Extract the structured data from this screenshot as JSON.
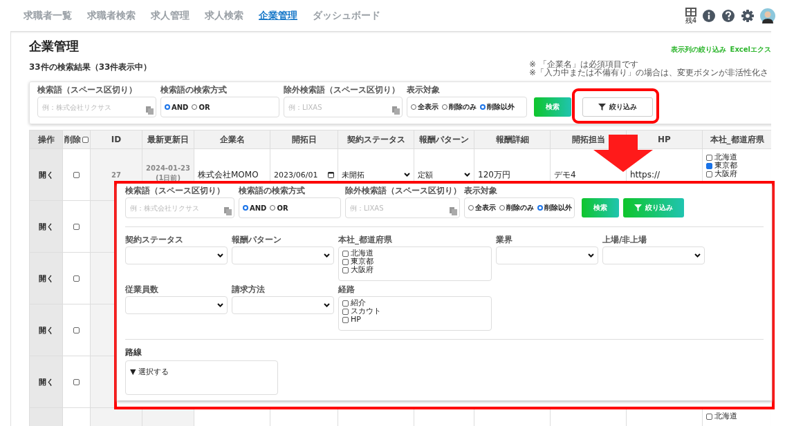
{
  "nav": {
    "tabs": [
      {
        "label": "求職者一覧",
        "selected": false
      },
      {
        "label": "求職者検索",
        "selected": false
      },
      {
        "label": "求人管理",
        "selected": false
      },
      {
        "label": "求人検索",
        "selected": false
      },
      {
        "label": "企業管理",
        "selected": true
      },
      {
        "label": "ダッシュボード",
        "selected": false
      }
    ],
    "quota": "残4"
  },
  "page": {
    "title": "企業管理",
    "result_count": "33件の検索結果（33件表示中）",
    "links": [
      "表示列の絞り込み",
      "Excelエクス"
    ],
    "notes": [
      "※ 「企業名」は必須項目です",
      "※「入力中または不備有り」の場合は、変更ボタンが非活性化さ"
    ]
  },
  "search_bar": {
    "keyword": {
      "label": "検索語（スペース区切り）",
      "placeholder": "例：株式会社リクサス"
    },
    "method": {
      "label": "検索語の検索方式",
      "options": [
        {
          "label": "AND",
          "selected": true
        },
        {
          "label": "OR",
          "selected": false
        }
      ]
    },
    "exclude": {
      "label": "除外検索語（スペース区切り）",
      "placeholder": "例：LIXAS"
    },
    "scope": {
      "label": "表示対象",
      "options": [
        {
          "label": "全表示",
          "selected": false
        },
        {
          "label": "削除のみ",
          "selected": false
        },
        {
          "label": "削除以外",
          "selected": true
        }
      ]
    },
    "search_button": "検索",
    "filter_button": "絞り込み"
  },
  "table": {
    "columns": [
      "操作",
      "削除",
      "ID",
      "最新更新日",
      "企業名",
      "開拓日",
      "契約ステータス",
      "報酬パターン",
      "報酬詳細",
      "開拓担当",
      "HP",
      "本社_都道府県"
    ],
    "delete_all_checked": false,
    "rows": [
      {
        "open": "開く",
        "deleted": false,
        "id": "27",
        "updated": "2024-01-23",
        "updated_ago": "(1日前)",
        "company": "株式会社MOMO",
        "date": "2023/06/01",
        "status": "未開拓",
        "pattern": "定額",
        "detail": "120万円",
        "owner": "デモ4",
        "hp": "https://",
        "prefectures": [
          {
            "label": "北海道",
            "checked": false
          },
          {
            "label": "東京都",
            "checked": true
          },
          {
            "label": "大阪府",
            "checked": false
          }
        ]
      },
      {
        "open": "開く",
        "deleted": false
      },
      {
        "open": "開く",
        "deleted": false
      },
      {
        "open": "開く",
        "deleted": false
      },
      {
        "open": "開く",
        "deleted": false
      },
      {
        "prefectures": [
          {
            "label": "北海道",
            "checked": false
          }
        ]
      }
    ]
  },
  "filter_popup": {
    "search_bar": {
      "keyword": {
        "label": "検索語（スペース区切り）",
        "placeholder": "例：株式会社リクサス"
      },
      "method": {
        "label": "検索語の検索方式",
        "options": [
          {
            "label": "AND",
            "selected": true
          },
          {
            "label": "OR",
            "selected": false
          }
        ]
      },
      "exclude": {
        "label": "除外検索語（スペース区切り）",
        "placeholder": "例：LIXAS"
      },
      "scope": {
        "label": "表示対象",
        "options": [
          {
            "label": "全表示",
            "selected": false
          },
          {
            "label": "削除のみ",
            "selected": false
          },
          {
            "label": "削除以外",
            "selected": true
          }
        ]
      },
      "search_button": "検索",
      "filter_button": "絞り込み"
    },
    "fields": [
      {
        "kind": "select",
        "label": "契約ステータス"
      },
      {
        "kind": "select",
        "label": "報酬パターン"
      },
      {
        "kind": "checklist",
        "label": "本社_都道府県",
        "options": [
          {
            "label": "北海道",
            "checked": false
          },
          {
            "label": "東京都",
            "checked": false
          },
          {
            "label": "大阪府",
            "checked": false
          }
        ]
      },
      {
        "kind": "select",
        "label": "業界"
      },
      {
        "kind": "select",
        "label": "上場/非上場"
      },
      {
        "kind": "select",
        "label": "従業員数"
      },
      {
        "kind": "select",
        "label": "請求方法"
      },
      {
        "kind": "checklist",
        "label": "経路",
        "options": [
          {
            "label": "紹介",
            "checked": false
          },
          {
            "label": "スカウト",
            "checked": false
          },
          {
            "label": "HP",
            "checked": false
          }
        ]
      }
    ],
    "route": {
      "label": "路線",
      "toggle": "▼ 選択する"
    }
  }
}
